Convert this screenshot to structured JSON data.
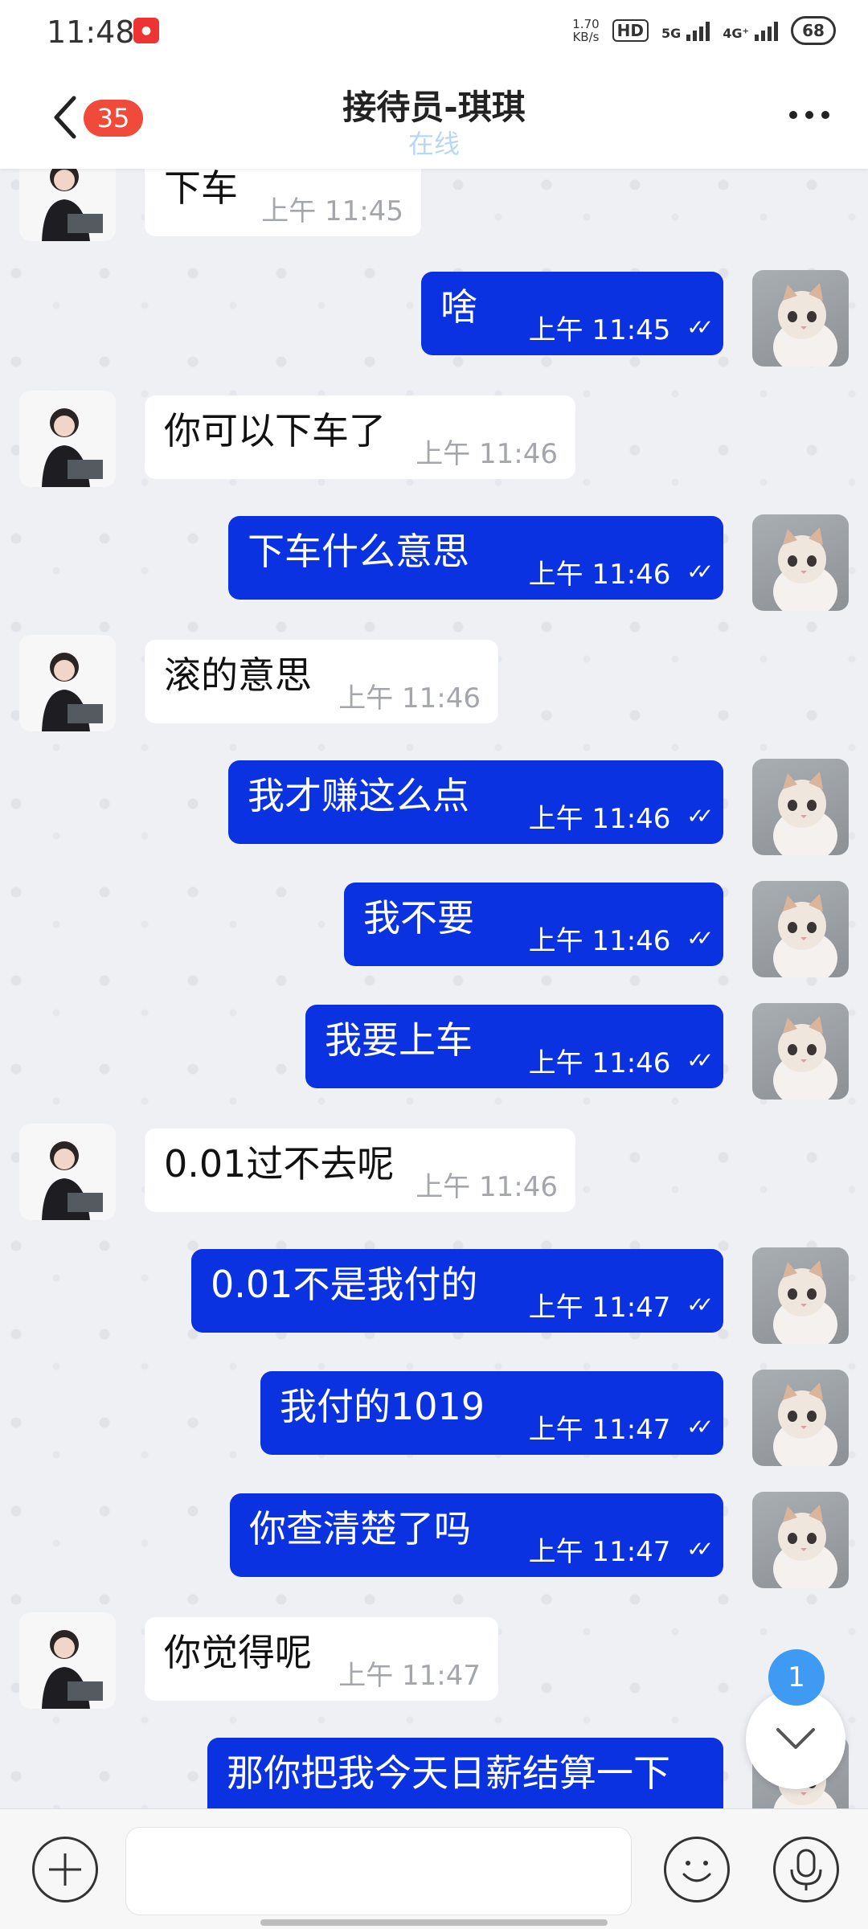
{
  "status_bar": {
    "time": "11:48",
    "net_speed_value": "1.70",
    "net_speed_unit": "KB/s",
    "hd_label": "HD",
    "net1": "5G",
    "net2": "4G⁺",
    "battery": "68"
  },
  "header": {
    "unread_badge": "35",
    "title": "接待员-琪琪",
    "subtitle": "在线"
  },
  "messages": [
    {
      "side": "in",
      "text": "下车",
      "time": "上午 11:45"
    },
    {
      "side": "out",
      "text": "啥",
      "time": "上午 11:45"
    },
    {
      "side": "in",
      "text": "你可以下车了",
      "time": "上午 11:46"
    },
    {
      "side": "out",
      "text": "下车什么意思",
      "time": "上午 11:46"
    },
    {
      "side": "in",
      "text": "滚的意思",
      "time": "上午 11:46"
    },
    {
      "side": "out",
      "text": "我才赚这么点",
      "time": "上午 11:46"
    },
    {
      "side": "out",
      "text": "我不要",
      "time": "上午 11:46"
    },
    {
      "side": "out",
      "text": "我要上车",
      "time": "上午 11:46"
    },
    {
      "side": "in",
      "text": "0.01过不去呢",
      "time": "上午 11:46"
    },
    {
      "side": "out",
      "text": "0.01不是我付的",
      "time": "上午 11:47"
    },
    {
      "side": "out",
      "text": "我付的1019",
      "time": "上午 11:47"
    },
    {
      "side": "out",
      "text": "你查清楚了吗",
      "time": "上午 11:47"
    },
    {
      "side": "in",
      "text": "你觉得呢",
      "time": "上午 11:47"
    },
    {
      "side": "out",
      "text": "那你把我今天日薪结算一下",
      "time": ""
    }
  ],
  "read_ticks": "✓✓",
  "new_message_count": "1",
  "colors": {
    "outgoing_bubble": "#0b32e0",
    "incoming_bubble": "#ffffff",
    "badge": "#f04a3a",
    "unread_dot": "#3e9af2",
    "online": "#b8d8f2"
  }
}
